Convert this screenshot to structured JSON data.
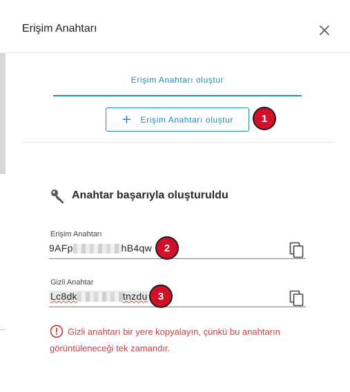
{
  "dialog": {
    "title": "Erişim Anahtarı"
  },
  "tabs": [
    {
      "label": "Erişim Anahtarı oluştur"
    }
  ],
  "create_button": {
    "label": "Erişim Anahtarı oluştur"
  },
  "badges": [
    "1",
    "2",
    "3"
  ],
  "success": {
    "message": "Anahtar başarıyla oluşturuldu"
  },
  "access_key": {
    "label": "Erişim Anahtarı",
    "value_start": "9AFp",
    "value_end": "hB4qw"
  },
  "secret_key": {
    "label": "Gizli Anahtar",
    "value_start": "Lc8dk",
    "value_end": "tnzdu"
  },
  "warning": {
    "line1": "Gizli anahtarı bir yere kopyalayın, çünkü bu anahtarın",
    "line2": "görüntüleneceği tek zamandır."
  },
  "colors": {
    "accent": "#1a8fb0",
    "badge": "#d3102a",
    "warning": "#d43a3a"
  }
}
